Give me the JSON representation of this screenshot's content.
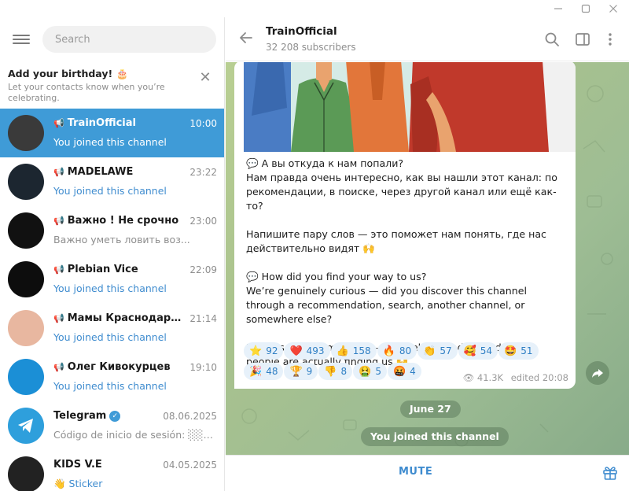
{
  "window": {
    "minimize_icon": "minimize-icon",
    "maximize_icon": "maximize-icon",
    "close_icon": "close-icon"
  },
  "sidebar": {
    "search_placeholder": "Search",
    "birthday": {
      "title": "Add your birthday! 🎂",
      "subtitle": "Let your contacts know when you’re celebrating."
    },
    "chats": [
      {
        "name": "TrainOfficial",
        "channel": true,
        "time": "10:00",
        "preview": "You joined this channel",
        "active": true,
        "avatar_color": "#3a3a3a"
      },
      {
        "name": "MADELAWE",
        "channel": true,
        "time": "23:22",
        "preview": "You joined this channel",
        "avatar_color": "#1c2630"
      },
      {
        "name": "Важно ! Не срочно",
        "channel": true,
        "time": "23:00",
        "preview": "Важно уметь ловить воз...",
        "preview_gray": true,
        "avatar_color": "#111111"
      },
      {
        "name": "Plebian Vice",
        "channel": true,
        "time": "22:09",
        "preview": "You joined this channel",
        "avatar_color": "#0d0d0d"
      },
      {
        "name": "Мамы Краснодара | ...",
        "channel": true,
        "time": "21:14",
        "preview": "You joined this channel",
        "avatar_color": "#e8b7a0"
      },
      {
        "name": "Олег Кивокурцев",
        "channel": true,
        "time": "19:10",
        "preview": "You joined this channel",
        "avatar_color": "#1b8fd6"
      },
      {
        "name": "Telegram",
        "verified": true,
        "time": "08.06.2025",
        "preview": "Código de inicio de sesión: ░░░░░",
        "preview_gray": true,
        "avatar_color": "#2e9fdc"
      },
      {
        "name": "KIDS V.E",
        "time": "04.05.2025",
        "preview": "👋 Sticker",
        "avatar_color": "#222222"
      }
    ]
  },
  "channel": {
    "title": "TrainOfficial",
    "subscribers": "32 208 subscribers",
    "message": "💬 А вы откуда к нам попали?\nНам правда очень интересно, как вы нашли этот канал: по рекомендации, в поиске, через другой канал или ещё как-то?\n\nНапишите пару слов — это поможет нам понять, где нас действительно видят 🙌\n\n💬 How did you find your way to us?\nWe’re genuinely curious — did you discover this channel through a recommendation, search, another channel, or somewhere else?\n\nDrop us a quick message — it’ll help us understand where people are actually finding us 🙌",
    "reactions": [
      {
        "emoji": "⭐",
        "count": "92"
      },
      {
        "emoji": "❤️",
        "count": "493"
      },
      {
        "emoji": "👍",
        "count": "158"
      },
      {
        "emoji": "🔥",
        "count": "80"
      },
      {
        "emoji": "👏",
        "count": "57"
      },
      {
        "emoji": "🥰",
        "count": "54"
      },
      {
        "emoji": "🤩",
        "count": "51"
      },
      {
        "emoji": "🎉",
        "count": "48"
      },
      {
        "emoji": "🏆",
        "count": "9"
      },
      {
        "emoji": "👎",
        "count": "8"
      },
      {
        "emoji": "🤮",
        "count": "5"
      },
      {
        "emoji": "🤬",
        "count": "4"
      }
    ],
    "views": "41.3K",
    "edited": "edited 20:08",
    "date_separator": "June 27",
    "service_message": "You joined this channel",
    "mute_label": "MUTE"
  }
}
